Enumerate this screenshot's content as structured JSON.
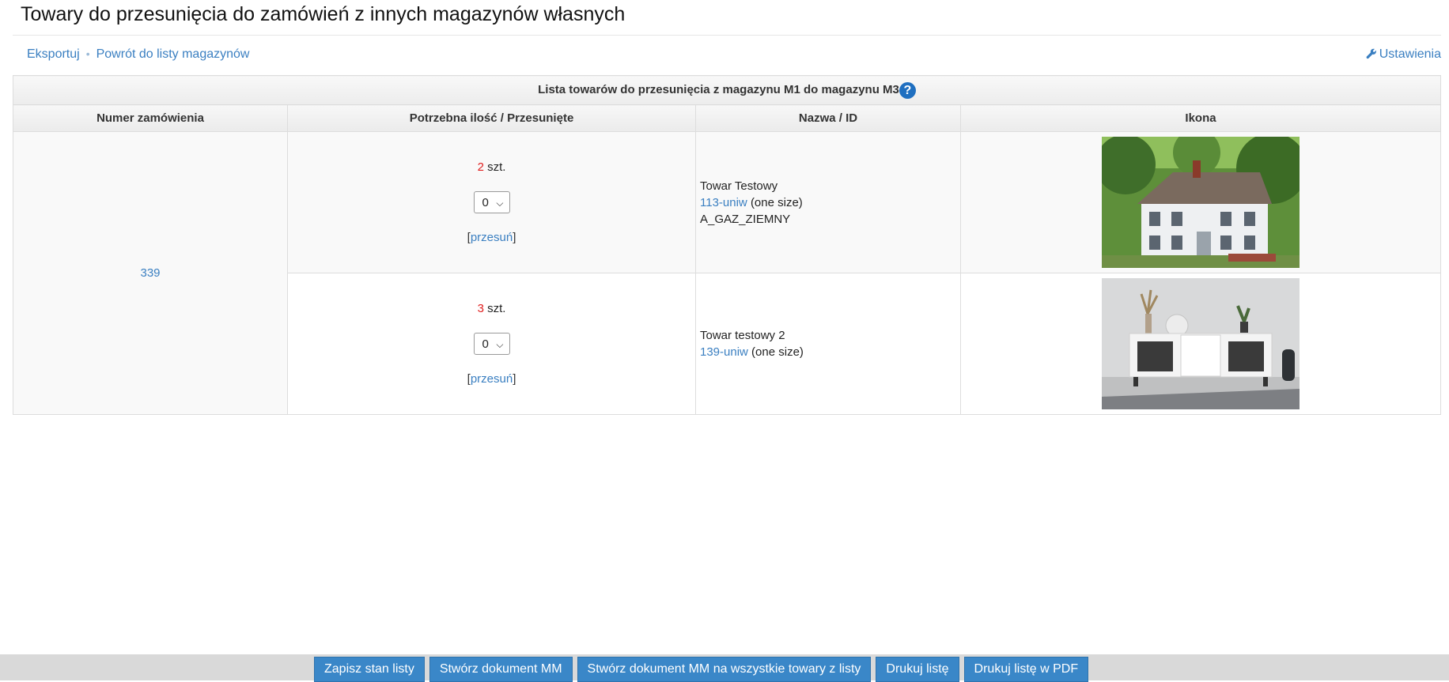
{
  "page": {
    "title": "Towary do przesunięcia do zamówień z innych magazynów własnych"
  },
  "toolbar": {
    "export_label": "Eksportuj",
    "separator": "•",
    "back_label": "Powrót do listy magazynów",
    "settings_label": "Ustawienia"
  },
  "table": {
    "caption": "Lista towarów do przesunięcia z magazynu M1 do magazynu M3",
    "help_icon_glyph": "?",
    "headers": [
      "Numer zamówienia",
      "Potrzebna ilość / Przesunięte",
      "Nazwa / ID",
      "Ikona"
    ],
    "order_number": "339",
    "rows": [
      {
        "qty": "2",
        "unit": "szt.",
        "select_value": "0",
        "move_label": "przesuń",
        "name": "Towar Testowy",
        "id_link": "113-uniw",
        "size": "(one size)",
        "extra": "A_GAZ_ZIEMNY",
        "image": "house-photo"
      },
      {
        "qty": "3",
        "unit": "szt.",
        "select_value": "0",
        "move_label": "przesuń",
        "name": "Towar testowy 2",
        "id_link": "139-uniw",
        "size": "(one size)",
        "extra": "",
        "image": "sideboard-photo"
      }
    ]
  },
  "bottom_buttons": [
    "Zapisz stan listy",
    "Stwórz dokument MM",
    "Stwórz dokument MM na wszystkie towary z listy",
    "Drukuj listę",
    "Drukuj listę w PDF"
  ],
  "colors": {
    "link": "#3a7fc1",
    "qty_red": "#e02020",
    "button": "#3a87c8",
    "help": "#1f6fc0"
  }
}
